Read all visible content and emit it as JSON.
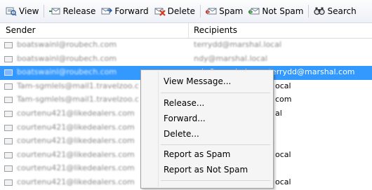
{
  "toolbar": {
    "buttons": [
      {
        "label": "View",
        "icon": "view-icon"
      },
      {
        "label": "Release",
        "icon": "release-icon"
      },
      {
        "label": "Forward",
        "icon": "forward-icon"
      },
      {
        "label": "Delete",
        "icon": "delete-icon"
      },
      {
        "label": "Spam",
        "icon": "spam-icon"
      },
      {
        "label": "Not Spam",
        "icon": "not-spam-icon"
      },
      {
        "label": "Search",
        "icon": "search-icon"
      }
    ]
  },
  "columns": {
    "sender": "Sender",
    "recipients": "Recipients"
  },
  "rows": [
    {
      "sender": "boatswainl@roubech.com",
      "recipients": "terrydd@marshal.local"
    },
    {
      "sender": "boatswainl@roubech.com",
      "recipients": "ndy@marshal.local"
    },
    {
      "sender": "boatswainl@roubech.com",
      "recipients": "ndy@marshal.com;terrydd@marshal.com",
      "selected": true
    },
    {
      "sender": "Tam-sgmlels@mail1.travelzoo.c",
      "recipients": "ocal"
    },
    {
      "sender": "Tam-sgmlels@mail1.travelzoo.c",
      "recipients": "com"
    },
    {
      "sender": "courtenu421@likedealers.com",
      "recipients": "al"
    },
    {
      "sender": "courtenu421@likedealers.com",
      "recipients": ""
    },
    {
      "sender": "courtenu421@likedealers.com",
      "recipients": ""
    },
    {
      "sender": "courtenu421@likedealers.com",
      "recipients": "ocal"
    },
    {
      "sender": "courtenu421@likedealers.com",
      "recipients": ""
    },
    {
      "sender": "courtenu421@likedealers.com",
      "recipients": "ocal"
    }
  ],
  "context_menu": {
    "items": [
      "View Message...",
      "Release...",
      "Forward...",
      "Delete...",
      "Report as Spam",
      "Report as Not Spam"
    ]
  },
  "colors": {
    "selection": "#3399ff",
    "toolbar_bg": "#eef1f7"
  }
}
